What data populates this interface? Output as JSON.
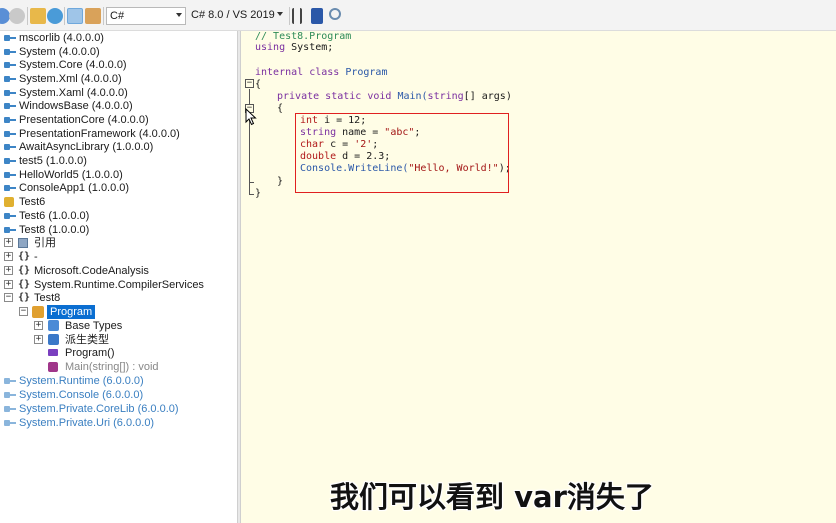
{
  "toolbar": {
    "language": "C#",
    "version": "C# 8.0 / VS 2019"
  },
  "tree": {
    "assemblies_top": [
      {
        "label": "mscorlib (4.0.0.0)"
      },
      {
        "label": "System (4.0.0.0)"
      },
      {
        "label": "System.Core (4.0.0.0)"
      },
      {
        "label": "System.Xml (4.0.0.0)"
      },
      {
        "label": "System.Xaml (4.0.0.0)"
      },
      {
        "label": "WindowsBase (4.0.0.0)"
      },
      {
        "label": "PresentationCore (4.0.0.0)"
      },
      {
        "label": "PresentationFramework (4.0.0.0)"
      },
      {
        "label": "AwaitAsyncLibrary (1.0.0.0)"
      },
      {
        "label": "test5 (1.0.0.0)"
      },
      {
        "label": "HelloWorld5 (1.0.0.0)"
      },
      {
        "label": "ConsoleApp1 (1.0.0.0)"
      },
      {
        "label": "Test6"
      },
      {
        "label": "Test6 (1.0.0.0)"
      },
      {
        "label": "Test8 (1.0.0.0)"
      }
    ],
    "test8_children": {
      "references": "引用",
      "dash_ns": "-",
      "ns_code_analysis": "Microsoft.CodeAnalysis",
      "ns_compiler_services": "System.Runtime.CompilerServices",
      "ns_test8": "Test8",
      "class_program": "Program",
      "base_types": "Base Types",
      "derived_types": "派生类型",
      "ctor": "Program()",
      "main": "Main(string[]) : void"
    },
    "assemblies_bottom": [
      {
        "label": "System.Runtime (6.0.0.0)"
      },
      {
        "label": "System.Console (6.0.0.0)"
      },
      {
        "label": "System.Private.CoreLib (6.0.0.0)"
      },
      {
        "label": "System.Private.Uri (6.0.0.0)"
      }
    ]
  },
  "code": {
    "line1": "// Test8.Program",
    "line2_kw": "using",
    "line2_rest": " System;",
    "line3_kw1": "internal",
    "line3_kw2": " class",
    "line3_name": " Program",
    "open_brace": "{",
    "main_kw1": "private",
    "main_kw2": " static",
    "main_kw3": " void",
    "main_name": " Main(",
    "main_kw4": "string",
    "main_rest": "[] args)",
    "inner_open": "{",
    "l_int_kw": "int",
    "l_int_rest": " i = 12;",
    "l_string_kw": "string",
    "l_string_rest": " name = ",
    "l_string_val": "\"abc\"",
    "l_string_end": ";",
    "l_char_kw": "char",
    "l_char_rest": " c = ",
    "l_char_val": "'2'",
    "l_char_end": ";",
    "l_double_kw": "double",
    "l_double_rest": " d = 2.3;",
    "l_console": "Console.",
    "l_writeline": "WriteLine(",
    "l_console_str": "\"Hello, World!\"",
    "l_console_end": ");",
    "inner_close": "}",
    "close_brace": "}"
  },
  "caption": "我们可以看到 var消失了",
  "colors": {
    "selection": "#0a6ed1",
    "code_bg": "#fffde6",
    "highlight_border": "#e02020",
    "muted_assembly": "#3a7fc1"
  }
}
